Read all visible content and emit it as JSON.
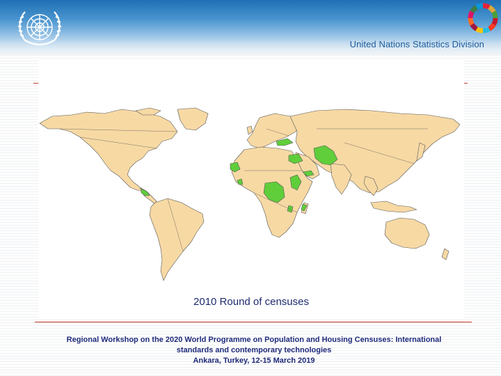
{
  "header": {
    "org_logo": "un-emblem",
    "sdg_logo": "sdg-color-wheel",
    "division_name": "United Nations Statistics Division"
  },
  "map": {
    "caption": "2010 Round of censuses",
    "land_color": "#f7d9a4",
    "highlight_color": "#5fce3a",
    "ocean_color": "#ffffff"
  },
  "footer": {
    "line1": "Regional Workshop on the 2020 World Programme on Population and Housing Censuses: International",
    "line2": "standards and contemporary technologies",
    "line3": "Ankara, Turkey, 12-15 March 2019"
  },
  "colors": {
    "accent_red": "#c0392b",
    "title_blue": "#1d5d9b"
  }
}
